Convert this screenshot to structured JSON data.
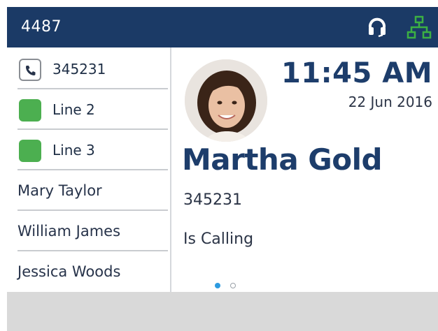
{
  "header": {
    "extension": "4487",
    "headset_icon": "headset-icon",
    "network_icon": "network-icon",
    "network_color": "#3cb043"
  },
  "sidebar": {
    "items": [
      {
        "label": "345231",
        "key": "phone-icon",
        "type": "line-key"
      },
      {
        "label": "Line 2",
        "key": "green-line-indicator",
        "type": "line-key",
        "color": "#4caf50"
      },
      {
        "label": "Line 3",
        "key": "green-line-indicator",
        "type": "line-key",
        "color": "#4caf50"
      },
      {
        "label": "Mary Taylor",
        "type": "contact"
      },
      {
        "label": "William James",
        "type": "contact"
      },
      {
        "label": "Jessica Woods",
        "type": "contact"
      }
    ]
  },
  "main": {
    "time": "11:45 AM",
    "date": "22 Jun 2016",
    "caller_name": "Martha Gold",
    "caller_number": "345231",
    "call_status": "Is Calling",
    "page_dots": {
      "total": 2,
      "active": 1
    }
  },
  "colors": {
    "header_bg": "#1b3a66",
    "accent_blue": "#1d3d6b",
    "softkey_bar": "#d9d9d9"
  }
}
